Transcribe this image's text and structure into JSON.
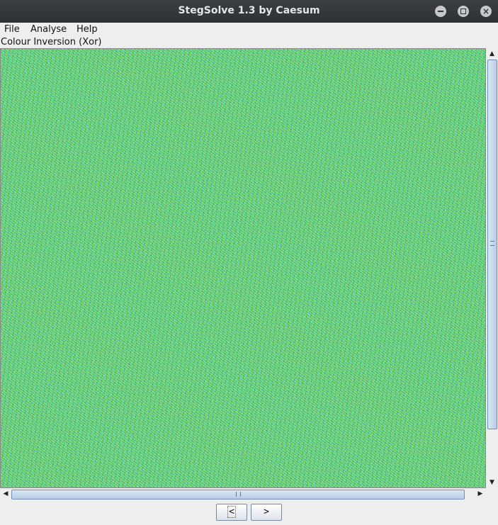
{
  "window": {
    "title": "StegSolve 1.3 by Caesum"
  },
  "window_controls": {
    "minimize_icon": "minimize-icon",
    "maximize_icon": "maximize-icon",
    "close_icon": "close-icon",
    "close_glyph": "×"
  },
  "menu": {
    "file": "File",
    "analyse": "Analyse",
    "help": "Help"
  },
  "viewer": {
    "mode_label": "Colour Inversion (Xor)",
    "image_description_color": "#3fc87a"
  },
  "scroll": {
    "up": "▲",
    "down": "▼",
    "left": "◀",
    "right": "▶"
  },
  "nav": {
    "prev_label": "<",
    "next_label": ">"
  }
}
